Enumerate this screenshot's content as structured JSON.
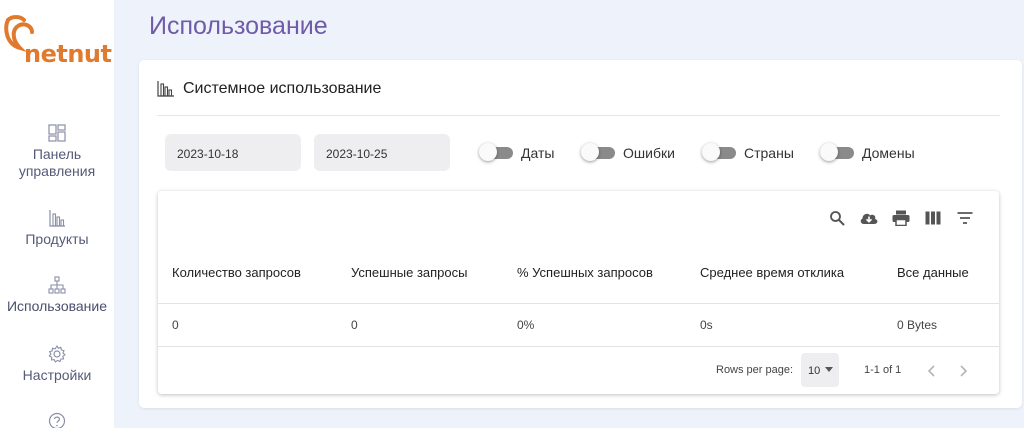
{
  "brand": {
    "logo_text": "netnut",
    "color": "#e07a2e"
  },
  "sidebar": {
    "items": [
      {
        "label": "Панель управления",
        "icon": "dashboard-icon"
      },
      {
        "label": "Продукты",
        "icon": "bar-chart-icon"
      },
      {
        "label": "Использование",
        "icon": "sitemap-icon",
        "active": true
      },
      {
        "label": "Настройки",
        "icon": "gear-icon"
      },
      {
        "label": "",
        "icon": "help-icon"
      }
    ]
  },
  "page": {
    "title": "Использование",
    "title_color": "#6f5ba8"
  },
  "card": {
    "title": "Системное использование",
    "title_icon": "bar-chart-icon"
  },
  "filters": {
    "date_from": "2023-10-18",
    "date_to": "2023-10-25",
    "toggles": [
      {
        "label": "Даты",
        "on": false
      },
      {
        "label": "Ошибки",
        "on": false
      },
      {
        "label": "Страны",
        "on": false
      },
      {
        "label": "Домены",
        "on": false
      }
    ]
  },
  "table": {
    "toolbar_icons": [
      "search-icon",
      "download-icon",
      "print-icon",
      "columns-icon",
      "filter-icon"
    ],
    "columns": [
      "Количество запросов",
      "Успешные запросы",
      "% Успешных запросов",
      "Среднее время отклика",
      "Все данные"
    ],
    "rows": [
      [
        "0",
        "0",
        "0%",
        "0s",
        "0 Bytes"
      ]
    ],
    "pagination": {
      "rows_per_page_label": "Rows per page:",
      "rows_per_page": "10",
      "range": "1-1 of 1"
    }
  }
}
